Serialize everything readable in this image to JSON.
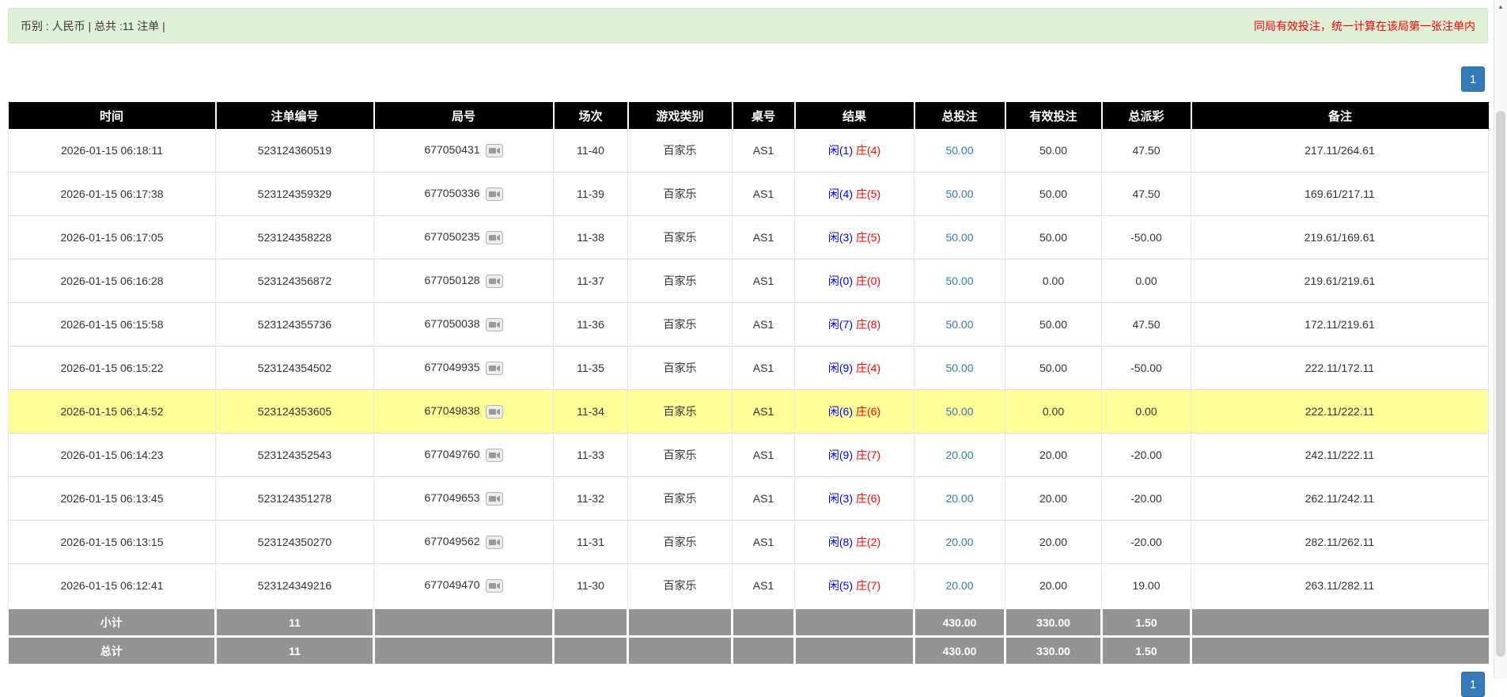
{
  "colors": {
    "alert_bg": "#dff0d8",
    "alert_border": "#d6e9c6",
    "alert_warning_text": "#ff0000",
    "pagination_bg": "#337ab7",
    "header_bg": "#000000",
    "header_text": "#ffffff",
    "row_highlight": "#ffff99",
    "player_blue": "#0000ff",
    "banker_red": "#ff0000",
    "link_blue": "#337ab7",
    "negative_red": "#ff0000",
    "summary_bg": "#949494"
  },
  "icons": {
    "video_icon": "video-camera",
    "scroll_up_icon": "▲"
  },
  "top_bar": {
    "left_text": "币别 : 人民币 | 总共 :11 注单 |",
    "right_text": "同局有效投注，统一计算在该局第一张注单内"
  },
  "pagination": {
    "page": "1"
  },
  "table": {
    "headers": [
      "时间",
      "注单编号",
      "局号",
      "场次",
      "游戏类别",
      "桌号",
      "结果",
      "总投注",
      "有效投注",
      "总派彩",
      "备注"
    ],
    "rows": [
      {
        "time": "2026-01-15 06:18:11",
        "bet_no": "523124360519",
        "round_no": "677050431",
        "session": "11-40",
        "game": "百家乐",
        "table_no": "AS1",
        "player": "闲(1)",
        "banker": "庄(4)",
        "total_bet": "50.00",
        "valid_bet": "50.00",
        "payout": "47.50",
        "remark": "217.11/264.61",
        "highlighted": false
      },
      {
        "time": "2026-01-15 06:17:38",
        "bet_no": "523124359329",
        "round_no": "677050336",
        "session": "11-39",
        "game": "百家乐",
        "table_no": "AS1",
        "player": "闲(4)",
        "banker": "庄(5)",
        "total_bet": "50.00",
        "valid_bet": "50.00",
        "payout": "47.50",
        "remark": "169.61/217.11",
        "highlighted": false
      },
      {
        "time": "2026-01-15 06:17:05",
        "bet_no": "523124358228",
        "round_no": "677050235",
        "session": "11-38",
        "game": "百家乐",
        "table_no": "AS1",
        "player": "闲(3)",
        "banker": "庄(5)",
        "total_bet": "50.00",
        "valid_bet": "50.00",
        "payout": "-50.00",
        "remark": "219.61/169.61",
        "highlighted": false
      },
      {
        "time": "2026-01-15 06:16:28",
        "bet_no": "523124356872",
        "round_no": "677050128",
        "session": "11-37",
        "game": "百家乐",
        "table_no": "AS1",
        "player": "闲(0)",
        "banker": "庄(0)",
        "total_bet": "50.00",
        "valid_bet": "0.00",
        "payout": "0.00",
        "remark": "219.61/219.61",
        "highlighted": false
      },
      {
        "time": "2026-01-15 06:15:58",
        "bet_no": "523124355736",
        "round_no": "677050038",
        "session": "11-36",
        "game": "百家乐",
        "table_no": "AS1",
        "player": "闲(7)",
        "banker": "庄(8)",
        "total_bet": "50.00",
        "valid_bet": "50.00",
        "payout": "47.50",
        "remark": "172.11/219.61",
        "highlighted": false
      },
      {
        "time": "2026-01-15 06:15:22",
        "bet_no": "523124354502",
        "round_no": "677049935",
        "session": "11-35",
        "game": "百家乐",
        "table_no": "AS1",
        "player": "闲(9)",
        "banker": "庄(4)",
        "total_bet": "50.00",
        "valid_bet": "50.00",
        "payout": "-50.00",
        "remark": "222.11/172.11",
        "highlighted": false
      },
      {
        "time": "2026-01-15 06:14:52",
        "bet_no": "523124353605",
        "round_no": "677049838",
        "session": "11-34",
        "game": "百家乐",
        "table_no": "AS1",
        "player": "闲(6)",
        "banker": "庄(6)",
        "total_bet": "50.00",
        "valid_bet": "0.00",
        "payout": "0.00",
        "remark": "222.11/222.11",
        "highlighted": true
      },
      {
        "time": "2026-01-15 06:14:23",
        "bet_no": "523124352543",
        "round_no": "677049760",
        "session": "11-33",
        "game": "百家乐",
        "table_no": "AS1",
        "player": "闲(9)",
        "banker": "庄(7)",
        "total_bet": "20.00",
        "valid_bet": "20.00",
        "payout": "-20.00",
        "remark": "242.11/222.11",
        "highlighted": false
      },
      {
        "time": "2026-01-15 06:13:45",
        "bet_no": "523124351278",
        "round_no": "677049653",
        "session": "11-32",
        "game": "百家乐",
        "table_no": "AS1",
        "player": "闲(3)",
        "banker": "庄(6)",
        "total_bet": "20.00",
        "valid_bet": "20.00",
        "payout": "-20.00",
        "remark": "262.11/242.11",
        "highlighted": false
      },
      {
        "time": "2026-01-15 06:13:15",
        "bet_no": "523124350270",
        "round_no": "677049562",
        "session": "11-31",
        "game": "百家乐",
        "table_no": "AS1",
        "player": "闲(8)",
        "banker": "庄(2)",
        "total_bet": "20.00",
        "valid_bet": "20.00",
        "payout": "-20.00",
        "remark": "282.11/262.11",
        "highlighted": false
      },
      {
        "time": "2026-01-15 06:12:41",
        "bet_no": "523124349216",
        "round_no": "677049470",
        "session": "11-30",
        "game": "百家乐",
        "table_no": "AS1",
        "player": "闲(5)",
        "banker": "庄(7)",
        "total_bet": "20.00",
        "valid_bet": "20.00",
        "payout": "19.00",
        "remark": "263.11/282.11",
        "highlighted": false
      }
    ],
    "footer": [
      {
        "label": "小计",
        "count": "11",
        "total_bet": "430.00",
        "valid_bet": "330.00",
        "payout": "1.50"
      },
      {
        "label": "总计",
        "count": "11",
        "total_bet": "430.00",
        "valid_bet": "330.00",
        "payout": "1.50"
      }
    ]
  }
}
